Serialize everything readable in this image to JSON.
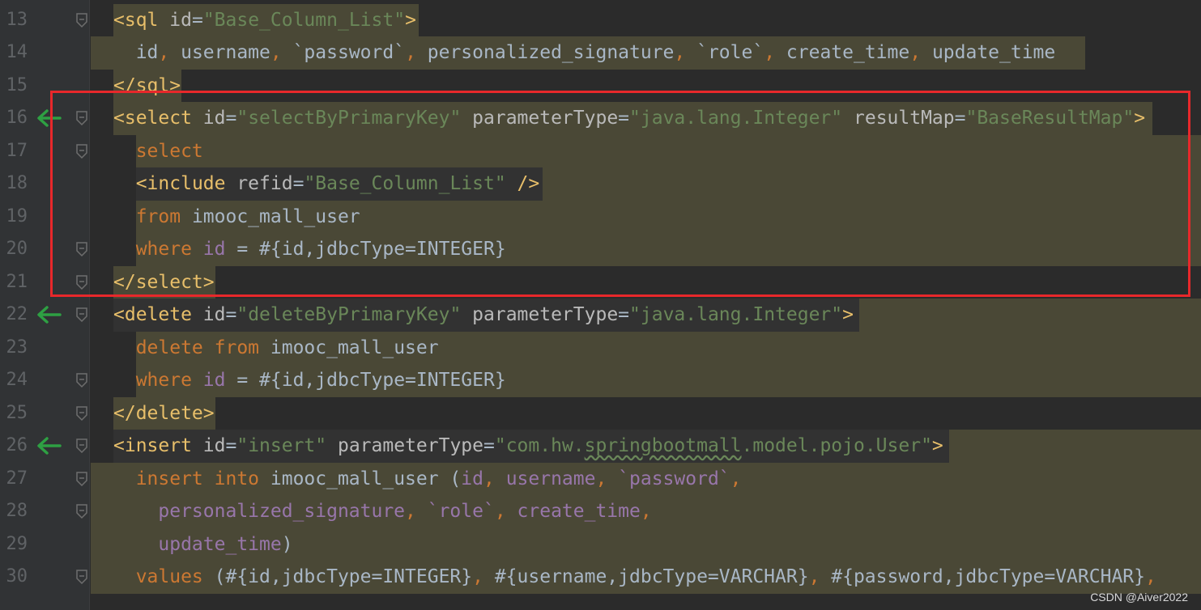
{
  "lines": [
    {
      "no": "13",
      "segs": [
        [
          "tag",
          "<sql "
        ],
        [
          "attr",
          "id"
        ],
        [
          "plain",
          "="
        ],
        [
          "val",
          "\"Base_Column_List\""
        ],
        [
          "tag",
          ">"
        ]
      ]
    },
    {
      "no": "14",
      "segs": [
        [
          "plain",
          "  id"
        ],
        [
          "kw",
          ", "
        ],
        [
          "plain",
          "username"
        ],
        [
          "kw",
          ", "
        ],
        [
          "plain",
          "`password`"
        ],
        [
          "kw",
          ", "
        ],
        [
          "plain",
          "personalized_signature"
        ],
        [
          "kw",
          ", "
        ],
        [
          "plain",
          "`role`"
        ],
        [
          "kw",
          ", "
        ],
        [
          "plain",
          "create_time"
        ],
        [
          "kw",
          ", "
        ],
        [
          "plain",
          "update_time"
        ]
      ]
    },
    {
      "no": "15",
      "segs": [
        [
          "tag",
          "</sql>"
        ]
      ]
    },
    {
      "no": "16",
      "segs": [
        [
          "tag",
          "<select "
        ],
        [
          "attr",
          "id"
        ],
        [
          "plain",
          "="
        ],
        [
          "val",
          "\"selectByPrimaryKey\""
        ],
        [
          "plain",
          " "
        ],
        [
          "attr",
          "parameterType"
        ],
        [
          "plain",
          "="
        ],
        [
          "val",
          "\"java.lang.Integer\""
        ],
        [
          "plain",
          " "
        ],
        [
          "attr",
          "resultMap"
        ],
        [
          "plain",
          "="
        ],
        [
          "val",
          "\"BaseResultMap\""
        ],
        [
          "tag",
          ">"
        ]
      ]
    },
    {
      "no": "17",
      "segs": [
        [
          "kw",
          "  select"
        ]
      ]
    },
    {
      "no": "18",
      "segs": [
        [
          "plain",
          "  "
        ],
        [
          "tag",
          "<include "
        ],
        [
          "attr",
          "refid"
        ],
        [
          "plain",
          "="
        ],
        [
          "val",
          "\"Base_Column_List\""
        ],
        [
          "plain",
          " "
        ],
        [
          "tag",
          "/>"
        ]
      ]
    },
    {
      "no": "19",
      "segs": [
        [
          "kw",
          "  from "
        ],
        [
          "plain",
          "imooc_mall_user"
        ]
      ]
    },
    {
      "no": "20",
      "segs": [
        [
          "kw",
          "  where "
        ],
        [
          "col",
          "id"
        ],
        [
          "plain",
          " = #{id,jdbcType=INTEGER}"
        ]
      ]
    },
    {
      "no": "21",
      "segs": [
        [
          "tag",
          "</select>"
        ]
      ]
    },
    {
      "no": "22",
      "segs": [
        [
          "tag",
          "<delete "
        ],
        [
          "attr",
          "id"
        ],
        [
          "plain",
          "="
        ],
        [
          "val",
          "\"deleteByPrimaryKey\""
        ],
        [
          "plain",
          " "
        ],
        [
          "attr",
          "parameterType"
        ],
        [
          "plain",
          "="
        ],
        [
          "val",
          "\"java.lang.Integer\""
        ],
        [
          "tag",
          ">"
        ]
      ]
    },
    {
      "no": "23",
      "segs": [
        [
          "kw",
          "  delete from "
        ],
        [
          "plain",
          "imooc_mall_user"
        ]
      ]
    },
    {
      "no": "24",
      "segs": [
        [
          "kw",
          "  where "
        ],
        [
          "col",
          "id"
        ],
        [
          "plain",
          " = #{id,jdbcType=INTEGER}"
        ]
      ]
    },
    {
      "no": "25",
      "segs": [
        [
          "tag",
          "</delete>"
        ]
      ]
    },
    {
      "no": "26",
      "segs": [
        [
          "tag",
          "<insert "
        ],
        [
          "attr",
          "id"
        ],
        [
          "plain",
          "="
        ],
        [
          "val",
          "\"insert\""
        ],
        [
          "plain",
          " "
        ],
        [
          "attr",
          "parameterType"
        ],
        [
          "plain",
          "="
        ],
        [
          "val",
          "\"com.hw."
        ],
        [
          "val squig",
          "springbootmall"
        ],
        [
          "val",
          ".model.pojo.User\""
        ],
        [
          "tag",
          ">"
        ]
      ]
    },
    {
      "no": "27",
      "segs": [
        [
          "kw",
          "  insert into "
        ],
        [
          "plain",
          "imooc_mall_user ("
        ],
        [
          "col",
          "id"
        ],
        [
          "kw",
          ", "
        ],
        [
          "col",
          "username"
        ],
        [
          "kw",
          ", "
        ],
        [
          "col",
          "`password`"
        ],
        [
          "kw",
          ","
        ]
      ]
    },
    {
      "no": "28",
      "segs": [
        [
          "plain",
          "    "
        ],
        [
          "col",
          "personalized_signature"
        ],
        [
          "kw",
          ", "
        ],
        [
          "col",
          "`role`"
        ],
        [
          "kw",
          ", "
        ],
        [
          "col",
          "create_time"
        ],
        [
          "kw",
          ","
        ]
      ]
    },
    {
      "no": "29",
      "segs": [
        [
          "plain",
          "    "
        ],
        [
          "col",
          "update_time"
        ],
        [
          "plain",
          ")"
        ]
      ]
    },
    {
      "no": "30",
      "segs": [
        [
          "kw",
          "  values "
        ],
        [
          "plain",
          "(#{id,jdbcType=INTEGER}"
        ],
        [
          "kw",
          ", "
        ],
        [
          "plain",
          "#{username,jdbcType=VARCHAR}"
        ],
        [
          "kw",
          ", "
        ],
        [
          "plain",
          "#{password,jdbcType=VARCHAR}"
        ],
        [
          "kw",
          ","
        ]
      ]
    }
  ],
  "watermark": "CSDN @Aiver2022",
  "colors": {
    "highlight_box": "#e8282b",
    "gutter_arrow": "#2ea043"
  }
}
